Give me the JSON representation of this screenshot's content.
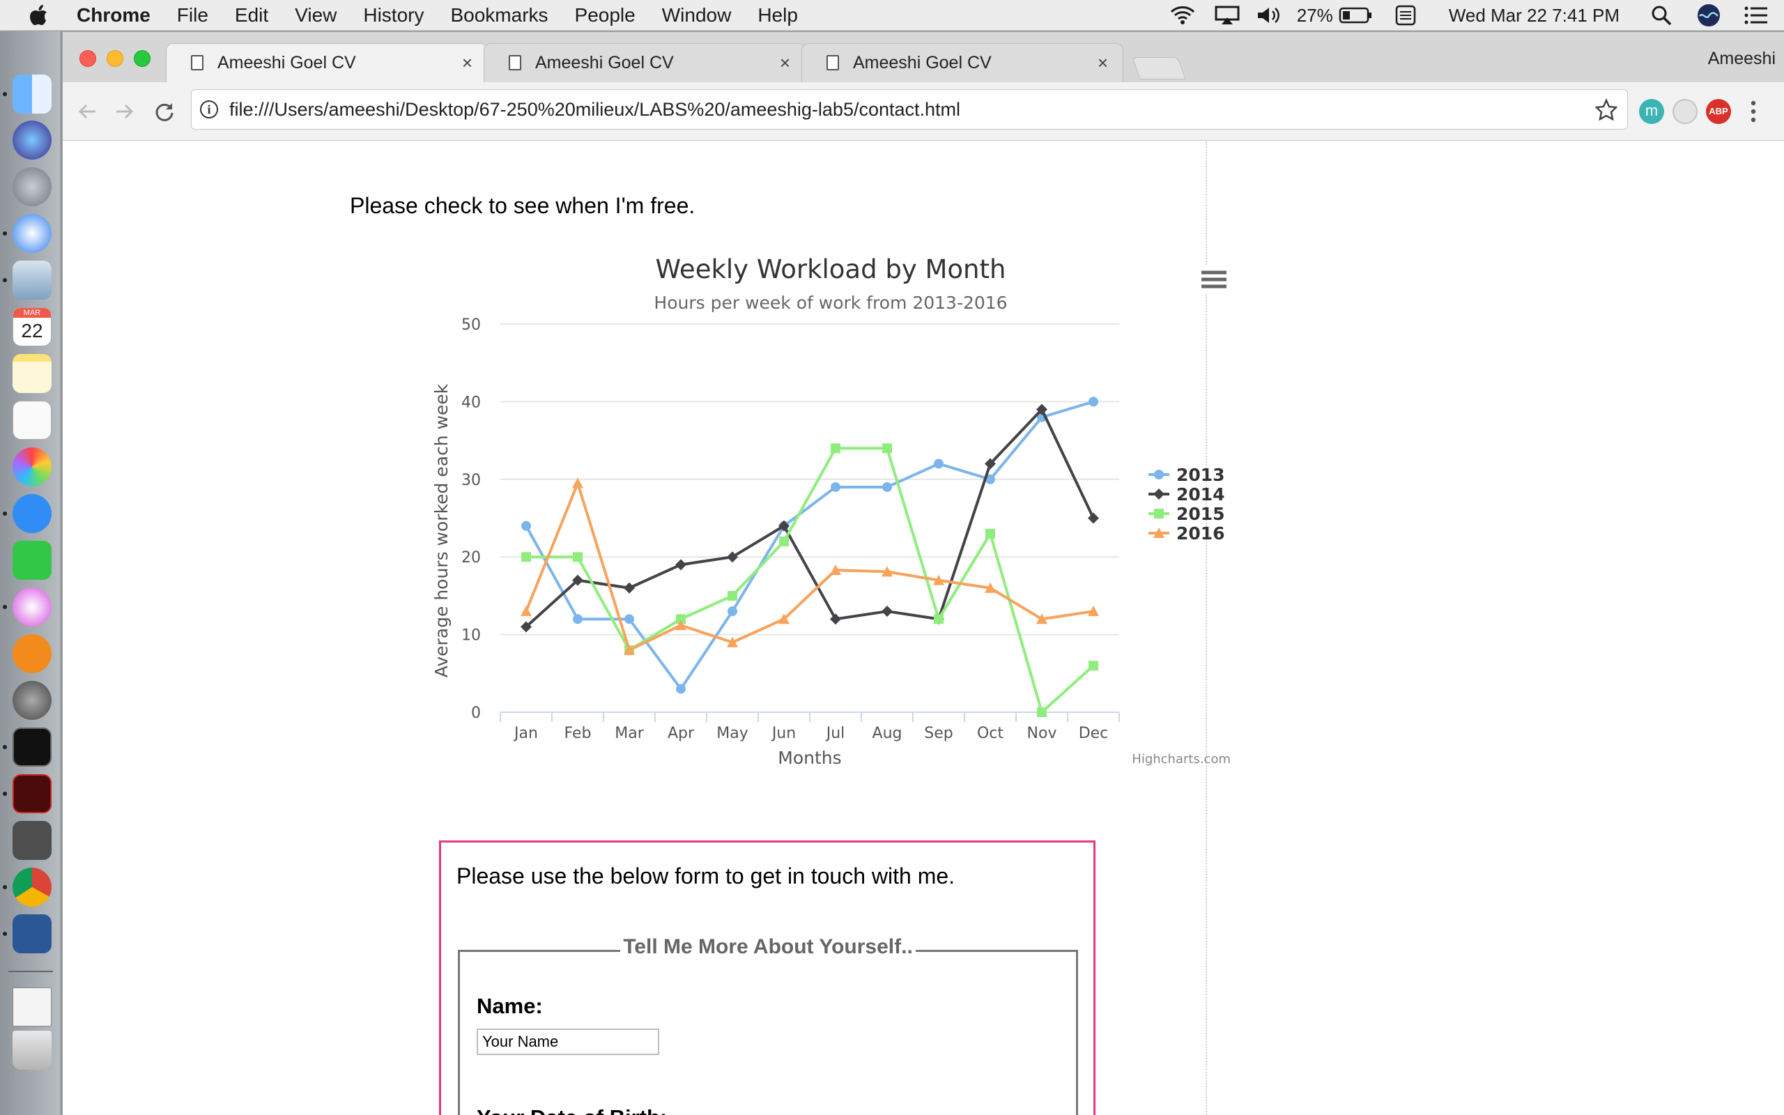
{
  "menubar": {
    "app_name": "Chrome",
    "items": [
      "File",
      "Edit",
      "View",
      "History",
      "Bookmarks",
      "People",
      "Window",
      "Help"
    ],
    "battery": "27%",
    "clock": "Wed Mar 22  7:41 PM"
  },
  "dock": {
    "calendar_month": "MAR",
    "calendar_day": "22"
  },
  "browser": {
    "tabs": [
      {
        "title": "Ameeshi Goel CV",
        "close": "×"
      },
      {
        "title": "Ameeshi Goel CV",
        "close": "×"
      },
      {
        "title": "Ameeshi Goel CV",
        "close": "×"
      }
    ],
    "profile": "Ameeshi",
    "url": "file:///Users/ameeshi/Desktop/67-250%20milieux/LABS%20/ameeshig-lab5/contact.html",
    "info_glyph": "i",
    "ext_abp": "ABP",
    "ext_m": "m"
  },
  "page": {
    "intro": "Please check to see when I'm free.",
    "contact_intro": "Please use the below form to get in touch with me.",
    "fieldset_legend": "Tell Me More About Yourself..",
    "name_label": "Name:",
    "name_value": "Your Name",
    "dob_label": "Your Date of Birth:"
  },
  "chart_data": {
    "type": "line",
    "title": "Weekly Workload by Month",
    "subtitle": "Hours per week of work from 2013-2016",
    "xlabel": "Months",
    "ylabel": "Average hours worked each week",
    "categories": [
      "Jan",
      "Feb",
      "Mar",
      "Apr",
      "May",
      "Jun",
      "Jul",
      "Aug",
      "Sep",
      "Oct",
      "Nov",
      "Dec"
    ],
    "ylim": [
      0,
      50
    ],
    "yticks": [
      0,
      10,
      20,
      30,
      40,
      50
    ],
    "grid": true,
    "legend_position": "right",
    "credits": "Highcharts.com",
    "series": [
      {
        "name": "2013",
        "color": "#7cb5ec",
        "marker": "circle",
        "values": [
          24,
          12,
          12,
          3,
          13,
          24,
          29,
          29,
          32,
          30,
          38,
          40
        ]
      },
      {
        "name": "2014",
        "color": "#434348",
        "marker": "diamond",
        "values": [
          11,
          17,
          16,
          19,
          20,
          24,
          12,
          13,
          12,
          32,
          39,
          25
        ]
      },
      {
        "name": "2015",
        "color": "#90ed7d",
        "marker": "square",
        "values": [
          20,
          20,
          8,
          12,
          15,
          22,
          34,
          34,
          12,
          23,
          0,
          6
        ]
      },
      {
        "name": "2016",
        "color": "#f7a35c",
        "marker": "triangle",
        "values": [
          13,
          29.5,
          8,
          11.2,
          9,
          12,
          18.3,
          18.1,
          17,
          16,
          12,
          13
        ]
      }
    ]
  }
}
